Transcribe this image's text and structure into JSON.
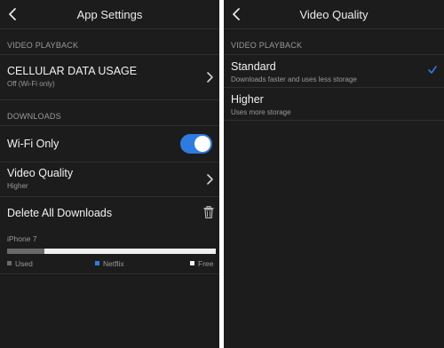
{
  "left": {
    "title": "App Settings",
    "section_video": "VIDEO PLAYBACK",
    "cellular": {
      "label": "CELLULAR DATA USAGE",
      "value": "Off (Wi-Fi only)"
    },
    "section_downloads": "DOWNLOADS",
    "wifi_only": {
      "label": "Wi-Fi Only",
      "on": true
    },
    "video_quality": {
      "label": "Video Quality",
      "value": "Higher"
    },
    "delete_all": "Delete All Downloads",
    "storage": {
      "device": "iPhone 7",
      "used_fraction": 0.18,
      "legend": {
        "used": "Used",
        "netflix": "Netflix",
        "free": "Free"
      },
      "colors": {
        "used": "#6a6a6a",
        "netflix": "#2f7be0",
        "free": "#f0f0f0"
      }
    }
  },
  "right": {
    "title": "Video Quality",
    "section": "VIDEO PLAYBACK",
    "options": [
      {
        "label": "Standard",
        "description": "Downloads faster and uses less storage",
        "selected": true
      },
      {
        "label": "Higher",
        "description": "Uses more storage",
        "selected": false
      }
    ]
  },
  "colors": {
    "accent": "#2f7be0",
    "background": "#1c1c1c"
  }
}
